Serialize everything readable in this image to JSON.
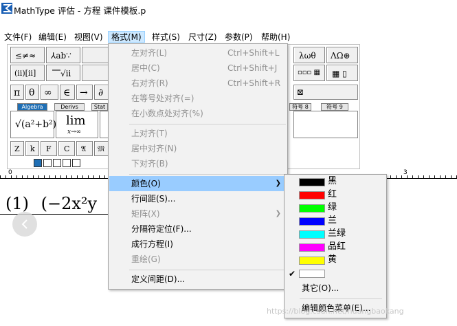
{
  "window": {
    "title": "MathType 评估 - 方程 课件模板.p"
  },
  "menubar": {
    "items": [
      "文件(F)",
      "编辑(E)",
      "视图(V)",
      "格式(M)",
      "样式(S)",
      "尺寸(Z)",
      "参数(P)",
      "帮助(H)"
    ]
  },
  "toolbar": {
    "row1": [
      "≤≠≈",
      "⅄ab∵",
      "",
      "",
      "",
      "",
      "",
      "λωθ",
      "ΛΩ⊛"
    ],
    "row2": [
      "(ⅱ)[ⅱ]",
      "⎺√ⅱ",
      "",
      "",
      "",
      "",
      "",
      "▫▫▫ ▦",
      "▦ ▯"
    ],
    "row3": [
      "π",
      "θ",
      "∞",
      "∈",
      "→",
      "∂",
      "",
      "",
      "",
      "",
      "",
      "⊠"
    ],
    "tabs": [
      "Algebra",
      "Derivs",
      "Stat",
      "符号 8",
      "符号 9"
    ],
    "templates": {
      "sqrt": "√(a²+b²)",
      "lim": "lim",
      "lim_sub": "x→∞"
    },
    "styles": [
      "Z",
      "k",
      "F",
      "C",
      "𝔄",
      "𝔐"
    ]
  },
  "document": {
    "formula_prefix": "(1)",
    "formula": "(−2x²y"
  },
  "format_menu": {
    "items": [
      {
        "label": "左对齐(L)",
        "shortcut": "Ctrl+Shift+L",
        "enabled": false
      },
      {
        "label": "居中(C)",
        "shortcut": "Ctrl+Shift+J",
        "enabled": false
      },
      {
        "label": "右对齐(R)",
        "shortcut": "Ctrl+Shift+R",
        "enabled": false
      },
      {
        "label": "在等号处对齐(=)",
        "shortcut": "",
        "enabled": false
      },
      {
        "label": "在小数点处对齐(%)",
        "shortcut": "",
        "enabled": false
      },
      {
        "label": "上对齐(T)",
        "shortcut": "",
        "enabled": false
      },
      {
        "label": "居中对齐(N)",
        "shortcut": "",
        "enabled": false
      },
      {
        "label": "下对齐(B)",
        "shortcut": "",
        "enabled": false
      },
      {
        "label": "颜色(O)",
        "shortcut": "",
        "enabled": true,
        "highlighted": true,
        "submenu": true
      },
      {
        "label": "行间距(S)...",
        "shortcut": "",
        "enabled": true
      },
      {
        "label": "矩阵(X)",
        "shortcut": "",
        "enabled": false,
        "submenu": true
      },
      {
        "label": "分隔符定位(F)...",
        "shortcut": "",
        "enabled": true
      },
      {
        "label": "成行方程(I)",
        "shortcut": "",
        "enabled": true
      },
      {
        "label": "重绘(G)",
        "shortcut": "",
        "enabled": false
      },
      {
        "label": "定义间距(D)...",
        "shortcut": "",
        "enabled": true
      }
    ]
  },
  "color_menu": {
    "items": [
      {
        "label": "黑",
        "color": "#000000"
      },
      {
        "label": "红",
        "color": "#ff0000"
      },
      {
        "label": "绿",
        "color": "#00ff00"
      },
      {
        "label": "兰",
        "color": "#0000ff"
      },
      {
        "label": "兰绿",
        "color": "#00ffff"
      },
      {
        "label": "品红",
        "color": "#ff00ff"
      },
      {
        "label": "黄",
        "color": "#ffff00"
      },
      {
        "label": "",
        "color": "#ffffff",
        "checked": true
      }
    ],
    "other": "其它(O)...",
    "edit": "编辑颜色菜单(E)..."
  },
  "ruler": {
    "labels": [
      "0",
      "3"
    ]
  },
  "watermark": "https://blog.csdn.net/huangbaokang",
  "colors": {
    "menu_highlight": "#99ccff",
    "menu_bg": "#f2f2f2",
    "tab_active": "#1f6fb5"
  }
}
